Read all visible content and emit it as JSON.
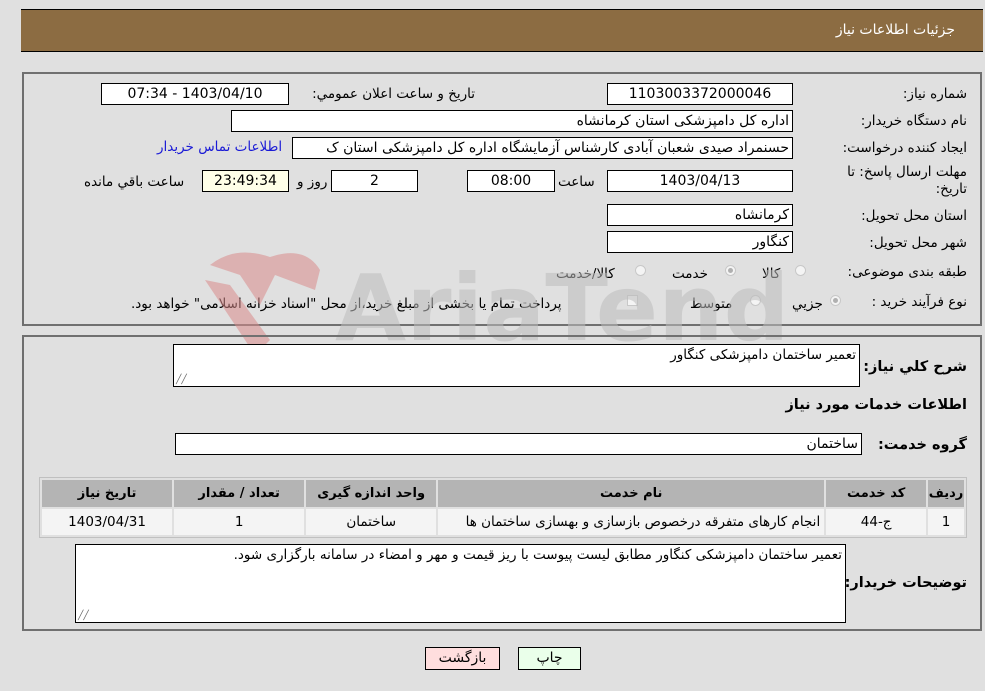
{
  "header": {
    "title": "جزئيات اطلاعات نياز"
  },
  "details": {
    "need_number": {
      "label": "شماره نياز:",
      "value": "1103003372000046"
    },
    "announce_datetime": {
      "label": "تاريخ و ساعت اعلان عمومي:",
      "value": "1403/04/10 - 07:34"
    },
    "buyer_org": {
      "label": "نام دستگاه خريدار:",
      "value": "اداره کل دامپزشکی استان کرمانشاه"
    },
    "requester": {
      "label": "ايجاد کننده درخواست:",
      "value": "حسنمراد صیدی شعبان آبادی کارشناس آزمایشگاه اداره کل دامپزشکی استان ک"
    },
    "contact_link": "اطلاعات تماس خريدار",
    "deadline": {
      "label": "مهلت ارسال پاسخ: تا تاريخ:",
      "date": "1403/04/13",
      "time_label": "ساعت",
      "time": "08:00",
      "days": "2",
      "days_label": "روز و",
      "remaining": "23:49:34",
      "remaining_label": "ساعت باقي مانده"
    },
    "delivery_province": {
      "label": "استان محل تحويل:",
      "value": "کرمانشاه"
    },
    "delivery_city": {
      "label": "شهر محل تحويل:",
      "value": "کنگاور"
    },
    "category": {
      "label": "طبقه بندی موضوعی:",
      "options": [
        "کالا",
        "خدمت",
        "کالا/خدمت"
      ],
      "selected": "خدمت"
    },
    "purchase_type": {
      "label": "نوع فرآيند خريد :",
      "options": [
        "جزيي",
        "متوسط"
      ],
      "selected": "جزيي",
      "treasury_note": "پرداخت تمام يا بخشی از مبلغ خريد،از محل \"اسناد خزانه اسلامی\" خواهد بود."
    }
  },
  "general_description": {
    "label": "شرح کلي نياز:",
    "value": "تعمیر ساختمان دامپزشکی کنگاور"
  },
  "services_section_title": "اطلاعات خدمات مورد نياز",
  "service_group": {
    "label": "گروه خدمت:",
    "value": "ساختمان"
  },
  "services_table": {
    "columns": [
      "رديف",
      "کد خدمت",
      "نام خدمت",
      "واحد اندازه گيری",
      "تعداد / مقدار",
      "تاريخ نياز"
    ],
    "rows": [
      [
        "1",
        "ج-44",
        "انجام کارهای متفرقه درخصوص بازسازی و بهسازی ساختمان ها",
        "ساختمان",
        "1",
        "1403/04/31"
      ]
    ]
  },
  "buyer_notes": {
    "label": "توضيحات خريدار:",
    "value": "تعمیر ساختمان دامپزشکی کنگاور مطابق لیست پیوست با ریز قیمت و مهر و امضاء در سامانه بارگزاری شود."
  },
  "buttons": {
    "print": "چاپ",
    "back": "بازگشت"
  },
  "watermark": {
    "text": "AriaTender.neT"
  },
  "colors": {
    "header_bg": "#8c6c42",
    "print_bg": "#eaffea",
    "back_bg": "#ffdede",
    "link": "#1a1ad6"
  }
}
